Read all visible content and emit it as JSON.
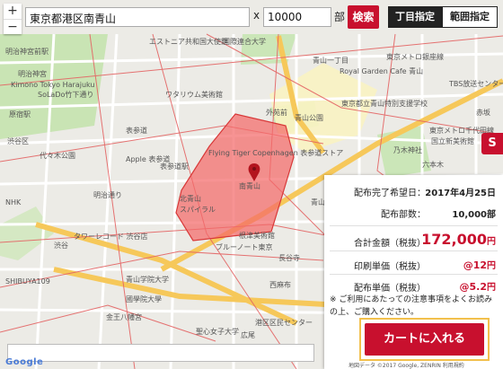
{
  "search": {
    "address_value": "東京都港区南青山",
    "times": "x",
    "quantity_value": "10000",
    "unit": "部",
    "search_label": "検索"
  },
  "tabs": {
    "chome": "丁目指定",
    "range": "範囲指定"
  },
  "zoom": {
    "in": "+",
    "out": "−"
  },
  "summary": {
    "date_label": "配布完了希望日：",
    "date_value": "2017年4月25日",
    "count_label": "配布部数：",
    "count_value": "10,000部",
    "total_label": "合計金額（税抜）",
    "total_value": "172,000",
    "total_unit": "円",
    "print_label": "印刷単価（税抜）",
    "print_value": "@12",
    "print_unit": "円",
    "dist_label": "配布単価（税抜）",
    "dist_value": "@5.2",
    "dist_unit": "円"
  },
  "note": "※ ご利用にあたっての注意事項をよくお読みの上、ご購入ください。",
  "cart_label": "カートに入れる",
  "side_tab": "S",
  "map": {
    "google": "Google",
    "attribution": "地図データ ©2017 Google, ZENRIN  利用規約",
    "labels": [
      "明治神宮前駅",
      "エストニア共和国大使館",
      "国際連合大学",
      "明治神宮",
      "表参道",
      "原宿駅",
      "Kimono Tokyo Harajuku",
      "SoLaDo竹下通り",
      "ワタリウム美術館",
      "外苑前",
      "青山一丁目",
      "Royal Garden Cafe 青山",
      "TBS放送センター",
      "赤坂",
      "東京都立青山特別支援学校",
      "青山公園",
      "Flying Tiger Copenhagen 表参道ストア",
      "表参道駅",
      "Apple 表参道",
      "南青山",
      "北青山",
      "スパイラル",
      "乃木神社",
      "六本木",
      "国立新美術館",
      "根津美術館",
      "長谷寺",
      "青山霊園",
      "渋谷区",
      "渋谷",
      "SHIBUYA109",
      "恵比寿",
      "代々木公園",
      "NHK",
      "明治通り",
      "ブルーノート東京",
      "タワーレコード 渋谷店",
      "青山学院大学",
      "國學院大學",
      "西麻布",
      "広尾",
      "金王八幡宮",
      "聖心女子大学",
      "港区区民センター",
      "東京メトロ千代田線",
      "東京メトロ銀座線"
    ]
  },
  "colors": {
    "accent": "#c8102e",
    "highlight_border": "#f2c04c",
    "area_fill": "#f46a6a"
  }
}
